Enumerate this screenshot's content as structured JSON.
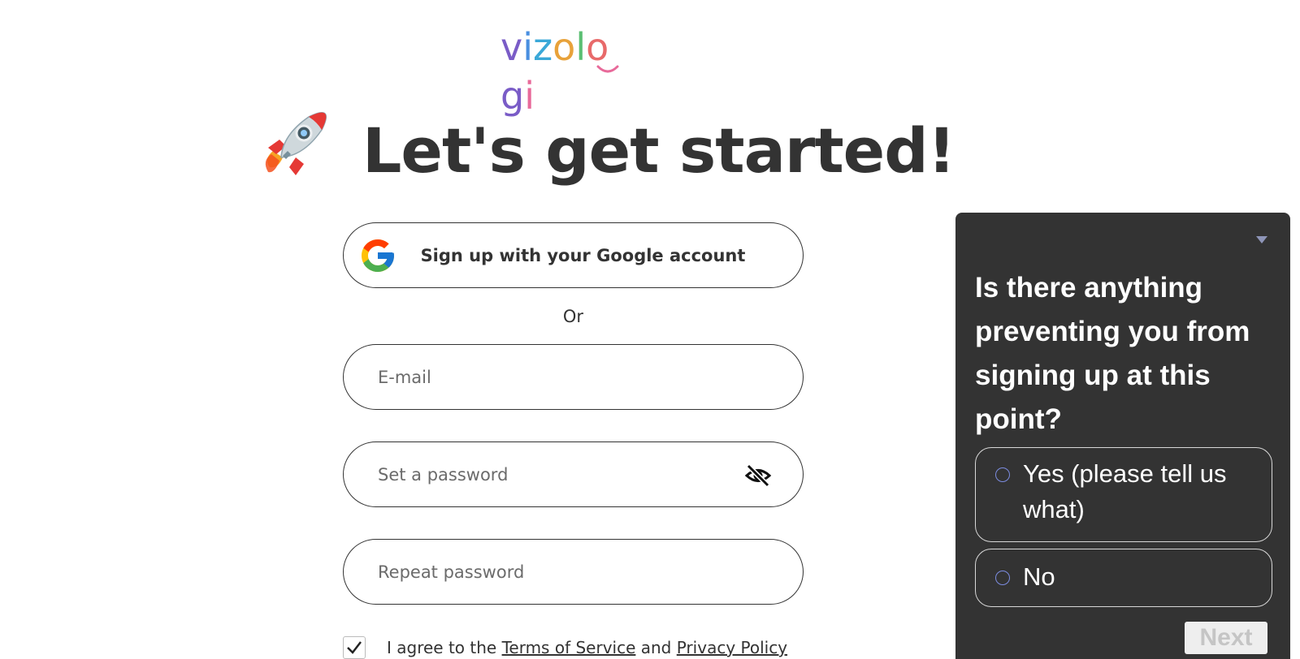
{
  "logo": {
    "text": "vizologi",
    "letters": [
      {
        "char": "v",
        "color": "#7a5cc7"
      },
      {
        "char": "i",
        "color": "#4a8fe0"
      },
      {
        "char": "z",
        "color": "#3aa8d8"
      },
      {
        "char": "o",
        "color": "#e8a23a"
      },
      {
        "char": "l",
        "color": "#5bbf73"
      },
      {
        "char": "o",
        "color": "#e86a6a"
      },
      {
        "char": "g",
        "color": "#7a5cc7"
      },
      {
        "char": "i",
        "color": "#e86a9a"
      }
    ]
  },
  "header": {
    "icon": "rocket-icon",
    "title": "Let's get started!"
  },
  "form": {
    "google_button_label": "Sign up with your Google account",
    "or_label": "Or",
    "email_placeholder": "E-mail",
    "password_placeholder": "Set a password",
    "repeat_password_placeholder": "Repeat password",
    "password_visibility_icon": "eye-slash-icon",
    "agree": {
      "checked": true,
      "prefix": "I agree to the",
      "terms_link": "Terms of Service",
      "and": "and",
      "privacy_link": "Privacy Policy"
    }
  },
  "survey": {
    "collapse_icon": "caret-down-icon",
    "question": "Is there anything preventing you from signing up at this point?",
    "options": [
      {
        "label": "Yes (please tell us what)"
      },
      {
        "label": "No"
      }
    ],
    "next_label": "Next"
  },
  "colors": {
    "text": "#333333",
    "survey_bg": "#333333",
    "radio_accent": "#7c8ce0",
    "next_bg": "#eeeeee",
    "next_text": "#c5c5c5"
  }
}
